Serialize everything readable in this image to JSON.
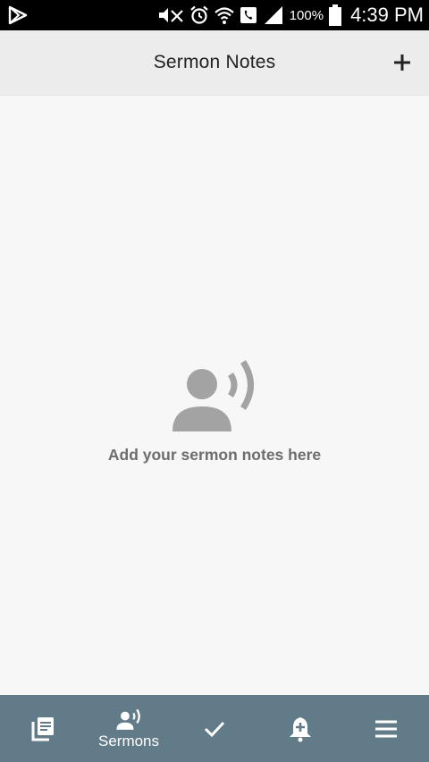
{
  "status_bar": {
    "battery_percent": "100%",
    "time": "4:39 PM",
    "icons": [
      "play-store-icon",
      "mute-icon",
      "alarm-icon",
      "wifi-call-icon",
      "phone-icon",
      "signal-icon",
      "battery-icon"
    ]
  },
  "header": {
    "title": "Sermon Notes",
    "add_icon": "plus-icon"
  },
  "empty_state": {
    "icon": "person-speaking-icon",
    "message": "Add your sermon notes here"
  },
  "bottom_nav": {
    "items": [
      {
        "icon": "notes-icon",
        "label": ""
      },
      {
        "icon": "sermons-icon",
        "label": "Sermons",
        "active": true
      },
      {
        "icon": "check-icon",
        "label": ""
      },
      {
        "icon": "bell-add-icon",
        "label": ""
      },
      {
        "icon": "menu-icon",
        "label": ""
      }
    ]
  },
  "colors": {
    "nav_background": "#617b88",
    "header_background": "#ececec",
    "content_background": "#f7f7f7",
    "empty_icon": "#a3a3a3",
    "empty_text": "#6d6d6d"
  }
}
